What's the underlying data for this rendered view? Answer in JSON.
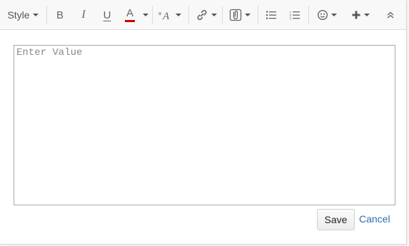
{
  "toolbar": {
    "style_label": "Style",
    "bold_label": "B",
    "italic_label": "I",
    "underline_label": "U",
    "font_color_label": "A",
    "font_color_bar": "#cc0000",
    "buttons": [
      {
        "name": "style-dropdown",
        "icon": "style"
      },
      {
        "name": "bold-button",
        "icon": "bold-icon"
      },
      {
        "name": "italic-button",
        "icon": "italic-icon"
      },
      {
        "name": "underline-button",
        "icon": "underline-icon"
      },
      {
        "name": "font-color-button",
        "icon": "font-color-icon"
      },
      {
        "name": "font-size-button",
        "icon": "font-size-icon"
      },
      {
        "name": "link-button",
        "icon": "link-icon"
      },
      {
        "name": "attachment-button",
        "icon": "paperclip-icon"
      },
      {
        "name": "bullet-list-button",
        "icon": "bullet-list-icon"
      },
      {
        "name": "numbered-list-button",
        "icon": "numbered-list-icon"
      },
      {
        "name": "emoji-button",
        "icon": "smiley-icon"
      },
      {
        "name": "insert-button",
        "icon": "plus-icon"
      },
      {
        "name": "collapse-toolbar-button",
        "icon": "double-chevron-up-icon"
      }
    ]
  },
  "editor": {
    "placeholder": "Enter Value",
    "value": ""
  },
  "actions": {
    "save_label": "Save",
    "cancel_label": "Cancel"
  }
}
